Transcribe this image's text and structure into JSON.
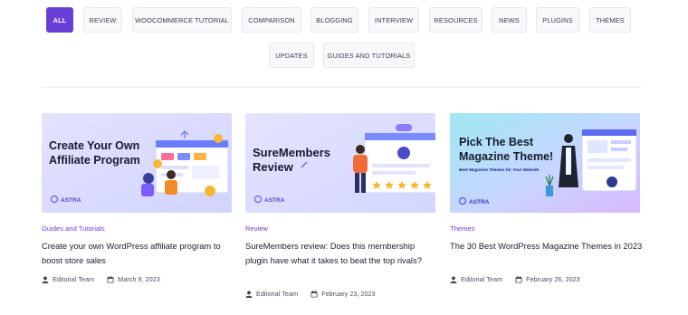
{
  "filters": {
    "row1": [
      {
        "label": "ALL",
        "active": true
      },
      {
        "label": "REVIEW"
      },
      {
        "label": "WOOCOMMERCE TUTORIAL"
      },
      {
        "label": "COMPARISON"
      },
      {
        "label": "BLOGGING"
      },
      {
        "label": "INTERVIEW"
      },
      {
        "label": "RESOURCES"
      },
      {
        "label": "NEWS"
      },
      {
        "label": "PLUGINS"
      },
      {
        "label": "THEMES"
      }
    ],
    "row2": [
      {
        "label": "UPDATES"
      },
      {
        "label": "GUIDES AND TUTORIALS"
      }
    ]
  },
  "posts": [
    {
      "category": "Guides and Tutorials",
      "title": "Create your own WordPress affiliate program to boost store sales",
      "author": "Editorial Team",
      "date": "March 9, 2023",
      "thumb": {
        "line1": "Create Your Own",
        "line2": "Affiliate Program",
        "brand": "ASTRA",
        "bg": "#dcdcff"
      }
    },
    {
      "category": "Review",
      "title": "SureMembers review: Does this membership plugin have what it takes to beat the top rivals?",
      "author": "Editorial Team",
      "date": "February 23, 2023",
      "thumb": {
        "line1": "SureMembers",
        "line2": "Review",
        "brand": "ASTRA",
        "bg": "#dfe0ff"
      }
    },
    {
      "category": "Themes",
      "title": "The 30 Best WordPress Magazine Themes in 2023",
      "author": "Editorial Team",
      "date": "February 26, 2023",
      "thumb": {
        "line1": "Pick The Best",
        "line2": "Magazine Theme!",
        "sub": "Best Magazine Themes for Your Website",
        "brand": "ASTRA",
        "bg": "#a8e9f5"
      }
    }
  ],
  "colors": {
    "accent": "#6a3fd8",
    "heading": "#1c2030"
  },
  "icons": {
    "author": "user-icon",
    "date": "calendar-icon"
  }
}
